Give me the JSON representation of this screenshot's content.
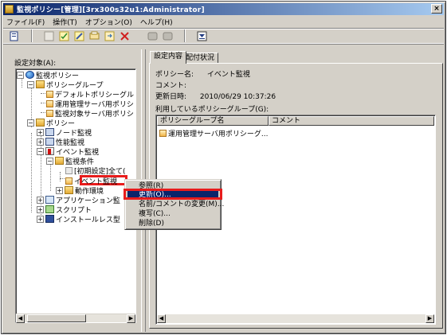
{
  "window": {
    "title": "監視ポリシー[管理][3rx300s32u1:Administrator]",
    "close_label": "×"
  },
  "menubar": [
    "ファイル(F)",
    "操作(T)",
    "オプション(O)",
    "ヘルプ(H)"
  ],
  "toolbar": {
    "icons": [
      "properties-icon",
      "list-icon",
      "check-icon",
      "edit-icon",
      "print-icon",
      "export-icon",
      "delete-icon",
      "disk-icon",
      "back-icon",
      "filter-icon"
    ]
  },
  "left": {
    "label": "設定対象(A):",
    "tree": [
      {
        "label": "監視ポリシー",
        "icon": "globe-icon",
        "expand": "−"
      },
      {
        "label": "ポリシーグループ",
        "icon": "folder-icon",
        "expand": "−"
      },
      {
        "label": "デフォルトポリシーグル",
        "icon": "document-icon",
        "expand": ""
      },
      {
        "label": "運用管理サーバ用ポリシ",
        "icon": "document-icon",
        "expand": ""
      },
      {
        "label": "監視対象サーバ用ポリシ",
        "icon": "document-icon",
        "expand": ""
      },
      {
        "label": "ポリシー",
        "icon": "folder-icon",
        "expand": "−"
      },
      {
        "label": "ノード監視",
        "icon": "monitor-icon",
        "expand": "+"
      },
      {
        "label": "性能監視",
        "icon": "chart-icon",
        "expand": "+"
      },
      {
        "label": "イベント監視",
        "icon": "event-icon",
        "expand": "−"
      },
      {
        "label": "監視条件",
        "icon": "folder-icon",
        "expand": "−"
      },
      {
        "label": "[初期設定]全て(",
        "icon": "document-icon",
        "expand": ""
      },
      {
        "label": "イベント監視",
        "icon": "document-icon",
        "expand": ""
      },
      {
        "label": "動作環境",
        "icon": "folder-icon",
        "expand": "+"
      },
      {
        "label": "アプリケーション監",
        "icon": "application-icon",
        "expand": "+"
      },
      {
        "label": "スクリプト",
        "icon": "script-icon",
        "expand": "+"
      },
      {
        "label": "インストールレス型",
        "icon": "install-icon",
        "expand": "+"
      }
    ]
  },
  "tabs": [
    {
      "label": "設定内容",
      "active": true
    },
    {
      "label": "配付状況",
      "active": false
    }
  ],
  "details": {
    "policy_name_label": "ポリシー名:",
    "policy_name_value": "イベント監視",
    "comment_label": "コメント:",
    "updated_label": "更新日時:",
    "updated_value": "2010/06/29 10:37:26",
    "groups_label": "利用しているポリシーグループ(G):"
  },
  "group_list": {
    "columns": [
      "ポリシーグループ名",
      "コメント"
    ],
    "rows": [
      {
        "name": "運用管理サーバ用ポリシーグ...",
        "comment": ""
      }
    ]
  },
  "context_menu": {
    "items": [
      "参照(R)",
      "更新(O)...",
      "名前/コメントの変更(M)...",
      "複写(C)...",
      "削除(D)"
    ],
    "highlighted_index": 1
  },
  "colors": {
    "highlight_box": "#e81c1c",
    "menu_highlight": "#0a246a",
    "window_face": "#d4d0c8"
  }
}
